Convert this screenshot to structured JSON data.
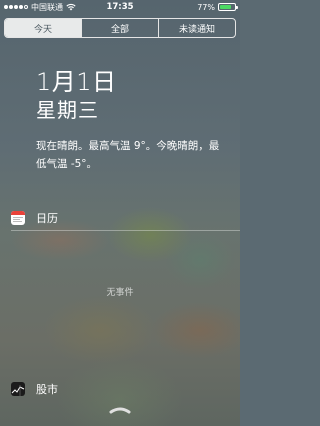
{
  "status_bar": {
    "carrier": "中国联通",
    "time": "17:35",
    "battery_percent": "77%",
    "battery_level": 0.77,
    "signal_bars": 5,
    "signal_filled": 4
  },
  "tabs": [
    {
      "label": "今天",
      "active": true
    },
    {
      "label": "全部",
      "active": false
    },
    {
      "label": "未读通知",
      "active": false
    }
  ],
  "today": {
    "date": "1月1日",
    "weekday": "星期三",
    "weather": "现在晴朗。最高气温 9°。今晚晴朗，最低气温 -5°。"
  },
  "calendar": {
    "title": "日历",
    "empty_text": "无事件"
  },
  "stocks": {
    "title": "股市"
  },
  "colors": {
    "battery_fill": "#4cd964",
    "calendar_red": "#e9423a",
    "active_tab_bg": "#e8eaea"
  }
}
